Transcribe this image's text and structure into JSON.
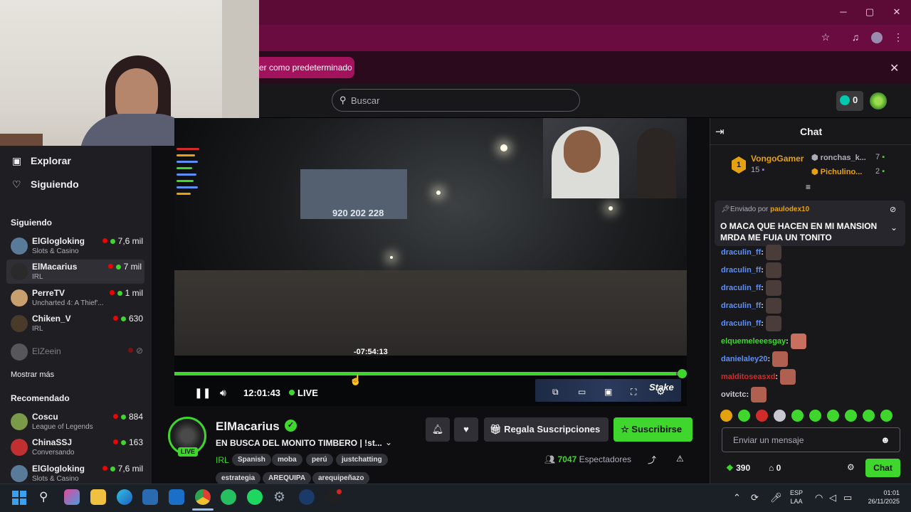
{
  "browser": {
    "infobar_text": "er como predeterminado",
    "window_controls": {
      "minimize": "─",
      "maximize": "▢",
      "close": "✕"
    }
  },
  "topnav": {
    "search_placeholder": "Buscar",
    "bits_count": "0"
  },
  "sidebar": {
    "nav": [
      {
        "label": "Explorar",
        "icon": "explore-icon"
      },
      {
        "label": "Siguiendo",
        "icon": "heart-icon"
      }
    ],
    "following_header": "Siguiendo",
    "following": [
      {
        "name": "ElGlogloking",
        "category": "Slots & Casino",
        "viewers": "7,6 mil",
        "avatar_color": "#5a7a9a"
      },
      {
        "name": "ElMacarius",
        "category": "IRL",
        "viewers": "7 mil",
        "avatar_color": "#2a2a2a"
      },
      {
        "name": "PerreTV",
        "category": "Uncharted 4: A Thief'...",
        "viewers": "1 mil",
        "avatar_color": "#c8a070"
      },
      {
        "name": "Chiken_V",
        "category": "IRL",
        "viewers": "630",
        "avatar_color": "#4a3a2a"
      }
    ],
    "offline_channel": "ElZeein",
    "show_more": "Mostrar más",
    "recommended_header": "Recomendado",
    "recommended": [
      {
        "name": "Coscu",
        "category": "League of Legends",
        "viewers": "884",
        "avatar_color": "#7a9a4a"
      },
      {
        "name": "ChinaSSJ",
        "category": "Conversando",
        "viewers": "163",
        "avatar_color": "#c03030"
      },
      {
        "name": "ElGlogloking",
        "category": "Slots & Casino",
        "viewers": "7,6 mil",
        "avatar_color": "#5a7a9a"
      }
    ]
  },
  "player": {
    "billboard_number": "920 202 228",
    "hover_time": "-07:54:13",
    "progress": 0.99,
    "elapsed": "12:01:43",
    "live_label": "LIVE",
    "sponsor_logo": "Stake"
  },
  "channel": {
    "name": "ElMacarius",
    "live_badge": "LIVE",
    "title": "EN BUSCA DEL MONITO TIMBERO | !st...",
    "category": "IRL",
    "tags_row1": [
      "Spanish",
      "moba",
      "perú",
      "justchatting"
    ],
    "tags_row2": [
      "estrategia",
      "AREQUIPA",
      "arequipeñazo"
    ],
    "gift_label": "Regala Suscripciones",
    "subscribe_label": "Suscribirse",
    "viewer_count": "7047",
    "viewer_label": "Espectadores"
  },
  "chat": {
    "title": "Chat",
    "leader": {
      "rank": "1",
      "name": "VongoGamer",
      "count": "15"
    },
    "leaderboard_side": [
      {
        "name": "ronchas_k...",
        "count": "7",
        "color": "#adadb8"
      },
      {
        "name": "Pichulino...",
        "count": "2",
        "color": "#e6a20e"
      }
    ],
    "pinned_prefix": "Enviado por",
    "pinned_by": "paulodex10",
    "pinned_message": "O MACA QUE HACEN EN MI MANSION MRDA ME FUIA UN TONITO",
    "messages": [
      {
        "user": "draculin_ff",
        "color": "#5f8ff5"
      },
      {
        "user": "draculin_ff",
        "color": "#5f8ff5"
      },
      {
        "user": "draculin_ff",
        "color": "#5f8ff5"
      },
      {
        "user": "draculin_ff",
        "color": "#5f8ff5"
      },
      {
        "user": "draculin_ff",
        "color": "#5f8ff5"
      },
      {
        "user": "elquemeleeesgay",
        "color": "#3fd62e"
      },
      {
        "user": "danielaley20",
        "color": "#5f8ff5"
      },
      {
        "user": "malditoseasxd",
        "color": "#d22b2b"
      },
      {
        "user": "ovitctc",
        "color": "#c8c8d0"
      }
    ],
    "input_placeholder": "Enviar un mensaje",
    "points": "390",
    "drops": "0",
    "send_label": "Chat"
  },
  "taskbar": {
    "lang_line1": "ESP",
    "lang_line2": "LAA",
    "time": "01:01",
    "date": "26/11/2025"
  }
}
